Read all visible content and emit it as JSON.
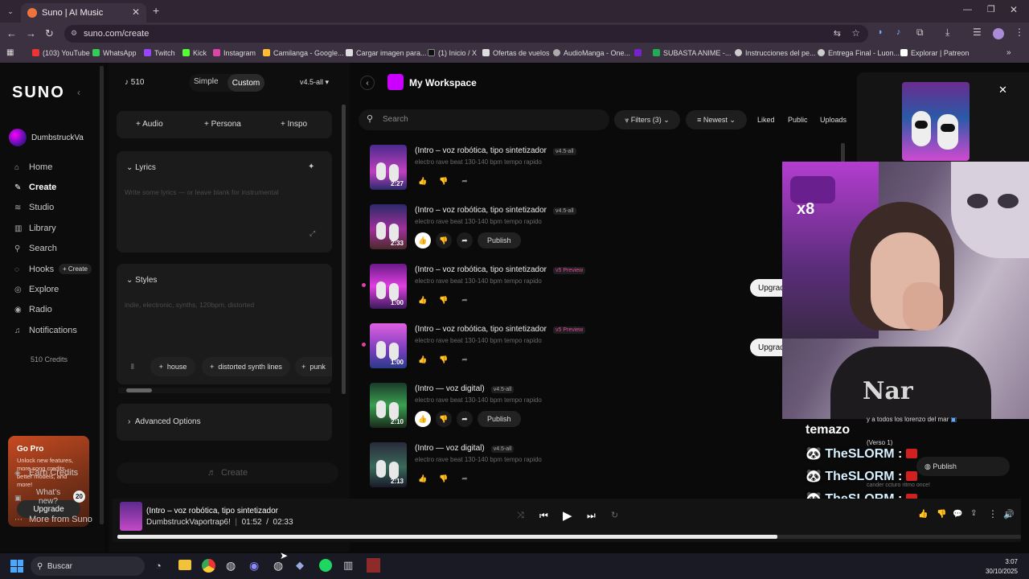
{
  "browser": {
    "tab_title": "Suno | AI Music",
    "url": "suno.com/create",
    "bookmarks": [
      "(103) YouTube",
      "WhatsApp",
      "Twitch",
      "Kick",
      "Instagram",
      "Camilanga - Google...",
      "Cargar imagen para...",
      "(1) Inicio / X",
      "Ofertas de vuelos",
      "AudioManga - One...",
      "SUBASTA ANIME -...",
      "Instrucciones del pe...",
      "Entrega Final - Luon...",
      "Explorar | Patreon"
    ]
  },
  "sidebar": {
    "logo": "SUNO",
    "user": "DumbstruckVa",
    "items": [
      {
        "label": "Home",
        "icon": "home-icon"
      },
      {
        "label": "Create",
        "icon": "create-icon"
      },
      {
        "label": "Studio",
        "icon": "studio-icon"
      },
      {
        "label": "Library",
        "icon": "library-icon"
      },
      {
        "label": "Search",
        "icon": "search-icon"
      },
      {
        "label": "Hooks",
        "icon": "hooks-icon",
        "badge": "+ Create"
      },
      {
        "label": "Explore",
        "icon": "explore-icon"
      },
      {
        "label": "Radio",
        "icon": "radio-icon"
      },
      {
        "label": "Notifications",
        "icon": "bell-icon"
      }
    ],
    "credits": "510 Credits",
    "gopro": {
      "title": "Go Pro",
      "text": "Unlock new features, more song credits, better models, and more!",
      "button": "Upgrade"
    },
    "earn": "Earn Credits",
    "whats_new": "What's new?",
    "whats_new_count": "20",
    "more": "More from Suno"
  },
  "create_panel": {
    "credits": "510",
    "mode_simple": "Simple",
    "mode_custom": "Custom",
    "model": "v4.5-all",
    "add_audio": "Audio",
    "add_persona": "Persona",
    "add_inspo": "Inspo",
    "lyrics_label": "Lyrics",
    "lyrics_placeholder": "Write some lyrics — or leave blank for instrumental",
    "styles_label": "Styles",
    "styles_placeholder": "indie, electronic, synths, 120bpm, distorted",
    "style_tags": [
      "house",
      "distorted synth lines",
      "punk"
    ],
    "advanced": "Advanced Options",
    "create_btn": "Create"
  },
  "workspace": {
    "title": "My Workspace",
    "search_placeholder": "Search",
    "filters": "Filters (3)",
    "sort": "Newest",
    "tabs": [
      "Liked",
      "Public",
      "Uploads"
    ],
    "rows": [
      {
        "title": "(Intro – voz robótica, tipo sintetizador",
        "tag": "v4.5-all",
        "desc": "electro rave beat 130-140 bpm tempo rapido",
        "dur": "2:27",
        "liked": false,
        "publish": "",
        "preview": false
      },
      {
        "title": "(Intro – voz robótica, tipo sintetizador",
        "tag": "v4.5-all",
        "desc": "electro rave beat 130-140 bpm tempo rapido",
        "dur": "2:33",
        "liked": true,
        "publish": "Publish",
        "preview": false
      },
      {
        "title": "(Intro – voz robótica, tipo sintetizador",
        "tag": "v5 Preview",
        "desc": "electro rave beat 130-140 bpm tempo rapido",
        "dur": "1:00",
        "liked": false,
        "publish": "",
        "preview": true
      },
      {
        "title": "(Intro – voz robótica, tipo sintetizador",
        "tag": "v5 Preview",
        "desc": "electro rave beat 130-140 bpm tempo rapido",
        "dur": "1:00",
        "liked": false,
        "publish": "",
        "preview": true
      },
      {
        "title": "(Intro — voz digital)",
        "tag": "v4.5-all",
        "desc": "electro rave beat 130-140 bpm tempo rapido",
        "dur": "2:10",
        "liked": true,
        "publish": "Publish",
        "preview": false
      },
      {
        "title": "(Intro — voz digital)",
        "tag": "v4.5-all",
        "desc": "electro rave beat 130-140 bpm tempo rapido",
        "dur": "2:13",
        "liked": false,
        "publish": "",
        "preview": false
      }
    ],
    "upgrade_label": "Upgrad"
  },
  "player": {
    "title": "(Intro – voz robótica, tipo sintetizador",
    "artist": "DumbstruckVaportrap6!",
    "elapsed": "01:52",
    "separator": "/",
    "total": "02:33",
    "progress": 0.73
  },
  "overlay": {
    "right_text1": "y a todos los lorenzo del mar",
    "right_text2": "(Verso 1)",
    "publish": "Publish",
    "small_text": "cander ccturo ritmo once!",
    "temazo": "temazo",
    "chat_name": "TheSLORM",
    "chat_lines": 4,
    "x8": "x8"
  },
  "taskbar": {
    "search": "Buscar",
    "time": "3:07",
    "date": "30/10/2025"
  }
}
